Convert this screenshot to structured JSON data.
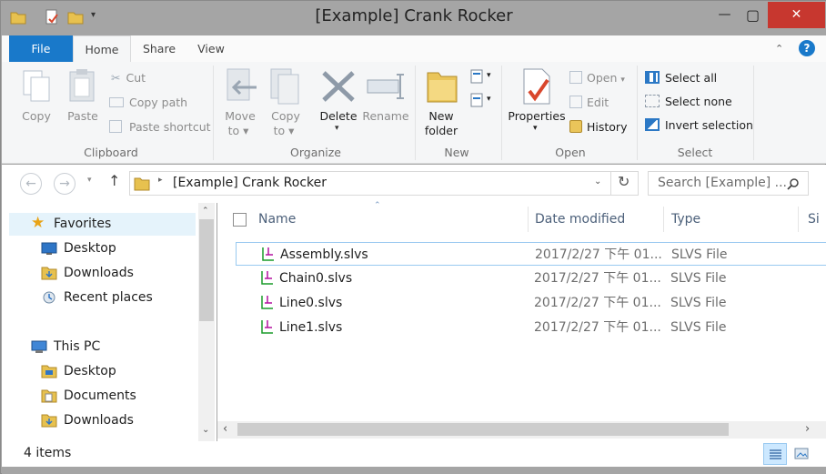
{
  "window": {
    "title": "[Example] Crank Rocker",
    "controls": {
      "minimize": "—",
      "maximize": "▢",
      "close": "✕"
    }
  },
  "ribbon_tabs": [
    "File",
    "Home",
    "Share",
    "View"
  ],
  "ribbon": {
    "clipboard": {
      "label": "Clipboard",
      "copy": "Copy",
      "paste": "Paste",
      "cut": "Cut",
      "copy_path": "Copy path",
      "paste_shortcut": "Paste shortcut"
    },
    "organize": {
      "label": "Organize",
      "move_to_1": "Move",
      "move_to_2": "to ▾",
      "copy_to_1": "Copy",
      "copy_to_2": "to ▾",
      "delete": "Delete",
      "rename": "Rename"
    },
    "new": {
      "label": "New",
      "new_folder_1": "New",
      "new_folder_2": "folder"
    },
    "open": {
      "label": "Open",
      "properties": "Properties",
      "open": "Open",
      "edit": "Edit",
      "history": "History"
    },
    "select": {
      "label": "Select",
      "select_all": "Select all",
      "select_none": "Select none",
      "invert_selection": "Invert selection"
    }
  },
  "address": {
    "path": "[Example] Crank Rocker",
    "search_placeholder": "Search [Example] ..."
  },
  "navigation": {
    "favorites": "Favorites",
    "fav_items": [
      "Desktop",
      "Downloads",
      "Recent places"
    ],
    "this_pc": "This PC",
    "pc_items": [
      "Desktop",
      "Documents",
      "Downloads"
    ]
  },
  "columns": {
    "name": "Name",
    "date_modified": "Date modified",
    "type": "Type",
    "size": "Si"
  },
  "files": [
    {
      "name": "Assembly.slvs",
      "date": "2017/2/27 下午 01...",
      "type": "SLVS File"
    },
    {
      "name": "Chain0.slvs",
      "date": "2017/2/27 下午 01...",
      "type": "SLVS File"
    },
    {
      "name": "Line0.slvs",
      "date": "2017/2/27 下午 01...",
      "type": "SLVS File"
    },
    {
      "name": "Line1.slvs",
      "date": "2017/2/27 下午 01...",
      "type": "SLVS File"
    }
  ],
  "status": {
    "item_count": "4 items"
  },
  "colors": {
    "accent": "#1979ca",
    "close": "#c7372f",
    "selection_border": "#99c9f0"
  }
}
